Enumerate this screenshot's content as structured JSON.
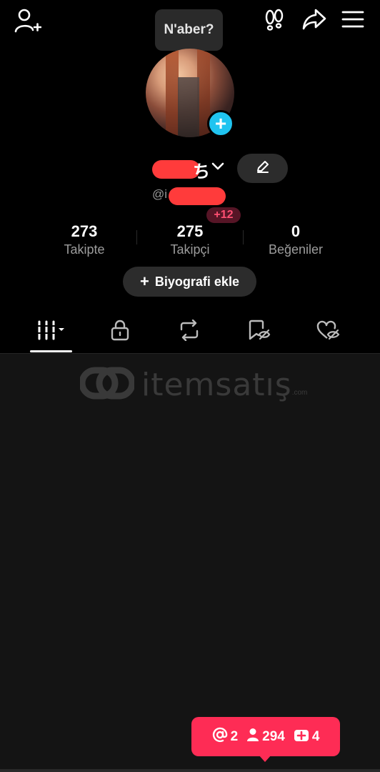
{
  "tooltip": {
    "text": "N'aber?"
  },
  "profile": {
    "name_visible": "ち",
    "handle_prefix": "@i",
    "new_followers_badge": "+12"
  },
  "stats": [
    {
      "value": "273",
      "label": "Takipte"
    },
    {
      "value": "275",
      "label": "Takipçi"
    },
    {
      "value": "0",
      "label": "Beğeniler"
    }
  ],
  "bio_button": {
    "plus": "+",
    "label": "Biyografi ekle"
  },
  "tabs": [
    {
      "icon": "videos-grid-icon",
      "active": true
    },
    {
      "icon": "lock-icon",
      "active": false
    },
    {
      "icon": "repost-icon",
      "active": false
    },
    {
      "icon": "bookmark-hidden-icon",
      "active": false
    },
    {
      "icon": "liked-hidden-icon",
      "active": false
    }
  ],
  "watermark": {
    "text": "itemsatış",
    "suffix": ".com"
  },
  "notifications": {
    "mentions": "2",
    "followers": "294",
    "likes": "4"
  },
  "colors": {
    "accent": "#fe2c55",
    "badge_blue": "#20c4f0",
    "background": "#141414"
  }
}
